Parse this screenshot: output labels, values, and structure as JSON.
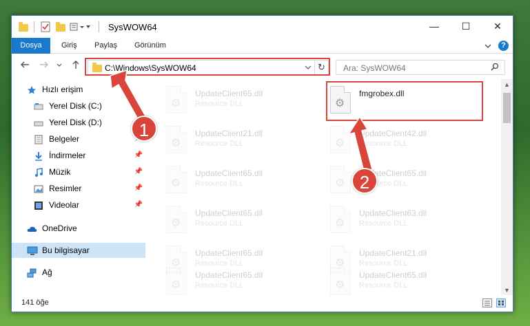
{
  "window": {
    "title": "SysWOW64",
    "controls": {
      "minimize": "—",
      "maximize": "☐",
      "close": "✕"
    }
  },
  "ribbon": {
    "tabs": [
      "Dosya",
      "Giriş",
      "Paylaş",
      "Görünüm"
    ],
    "help": "?"
  },
  "address": {
    "path": "C:\\Windows\\SysWOW64",
    "search_placeholder": "Ara: SysWOW64"
  },
  "nav": {
    "quick_access": "Hızlı erişim",
    "items": [
      {
        "label": "Yerel Disk (C:)",
        "pinned": false
      },
      {
        "label": "Yerel Disk (D:)",
        "pinned": false
      },
      {
        "label": "Belgeler",
        "pinned": true
      },
      {
        "label": "İndirmeler",
        "pinned": true
      },
      {
        "label": "Müzik",
        "pinned": true
      },
      {
        "label": "Resimler",
        "pinned": true
      },
      {
        "label": "Videolar",
        "pinned": true
      }
    ],
    "onedrive": "OneDrive",
    "this_pc": "Bu bilgisayar",
    "network": "Ağ"
  },
  "files": {
    "left": [
      {
        "name": "UpdateClient65.dll",
        "type": "Resource DLL"
      },
      {
        "name": "UpdateClient21.dll",
        "type": "Resource DLL"
      },
      {
        "name": "UpdateClient65.dll",
        "type": "Resource DLL"
      },
      {
        "name": "UpdateClient65.dll",
        "type": "Resource DLL"
      },
      {
        "name": "UpdateClient65.dll",
        "type": "Resource DLL"
      },
      {
        "name": "UpdateClient65.dll",
        "type": "Resource DLL"
      }
    ],
    "right": [
      {
        "name": "fmgrobex.dll",
        "type": ""
      },
      {
        "name": "UpdateClient42.dll",
        "type": "Resource DLL"
      },
      {
        "name": "UpdateClient65.dll",
        "type": "Resource DLL"
      },
      {
        "name": "UpdateClient63.dll",
        "type": "Resource DLL"
      },
      {
        "name": "UpdateClient21.dll",
        "type": "Resource DLL"
      },
      {
        "name": "UpdateClient65.dll",
        "type": "Resource DLL"
      }
    ]
  },
  "status": {
    "item_count": "141 öğe"
  },
  "annotations": {
    "step1": "1",
    "step2": "2",
    "color": "#d9453a"
  },
  "colors": {
    "accent": "#1979ca",
    "selection": "#cce4f7"
  }
}
